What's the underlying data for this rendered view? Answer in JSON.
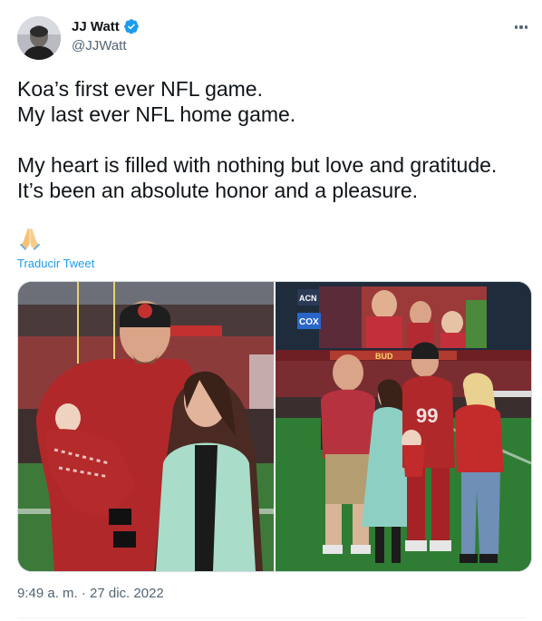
{
  "author": {
    "name": "JJ Watt",
    "handle": "@JJWatt",
    "avatar_icon": "profile-photo",
    "verified_icon": "verified-badge-icon"
  },
  "more_icon": "ellipsis-icon",
  "tweet": {
    "lines": [
      "Koa’s first ever NFL game.",
      "My last ever NFL home game.",
      "My heart is filled with nothing but love and gratitude.",
      "It’s been an absolute honor and a pleasure."
    ],
    "emoji": "🙏",
    "translate_label": "Traducir Tweet"
  },
  "media": {
    "photos": [
      {
        "description_icon": "photo-family-stadium"
      },
      {
        "description_icon": "photo-group-field-scoreboard"
      }
    ],
    "scoreboard_signs": [
      "ACN",
      "COX",
      "BUD"
    ]
  },
  "timestamp": "9:49 a. m. · 27 dic. 2022",
  "colors": {
    "link": "#1d9bf0",
    "secondary_text": "#536471",
    "verified": "#1d9bf0",
    "cardinals_red": "#97233f"
  }
}
